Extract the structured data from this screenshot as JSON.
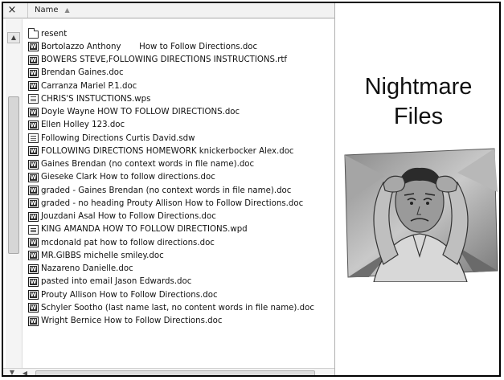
{
  "explorer": {
    "close_icon": "×",
    "column_header": "Name",
    "sort_icon": "sort-ascending-icon",
    "files": [
      {
        "name": "resent",
        "type": "folder"
      },
      {
        "name": "Bortolazzo Anthony       How to Follow Directions.doc",
        "type": "doc"
      },
      {
        "name": "BOWERS STEVE,FOLLOWING DIRECTIONS INSTRUCTIONS.rtf",
        "type": "doc"
      },
      {
        "name": "Brendan Gaines.doc",
        "type": "doc"
      },
      {
        "name": "Carranza Mariel P.1.doc",
        "type": "doc"
      },
      {
        "name": "CHRIS'S INSTUCTIONS.wps",
        "type": "wps"
      },
      {
        "name": "Doyle Wayne HOW TO FOLLOW DIRECTIONS.doc",
        "type": "doc"
      },
      {
        "name": "Ellen Holley 123.doc",
        "type": "doc"
      },
      {
        "name": "Following Directions Curtis David.sdw",
        "type": "wps"
      },
      {
        "name": "FOLLOWING DIRECTIONS HOMEWORK knickerbocker Alex.doc",
        "type": "doc"
      },
      {
        "name": "Gaines Brendan (no context words in file name).doc",
        "type": "doc"
      },
      {
        "name": "Gieseke Clark How to follow directions.doc",
        "type": "doc"
      },
      {
        "name": "graded - Gaines Brendan (no context words in file name).doc",
        "type": "doc"
      },
      {
        "name": "graded - no heading Prouty Allison How to Follow Directions.doc",
        "type": "doc"
      },
      {
        "name": "Jouzdani Asal How to Follow Directions.doc",
        "type": "doc"
      },
      {
        "name": "KING AMANDA HOW TO FOLLOW DIRECTIONS.wpd",
        "type": "wpd"
      },
      {
        "name": "mcdonald pat how to follow directions.doc",
        "type": "doc"
      },
      {
        "name": "MR.GIBBS michelle smiley.doc",
        "type": "doc"
      },
      {
        "name": "Nazareno Danielle.doc",
        "type": "doc"
      },
      {
        "name": "pasted into email Jason Edwards.doc",
        "type": "doc"
      },
      {
        "name": "Prouty Allison How to Follow Directions.doc",
        "type": "doc"
      },
      {
        "name": "Schyler Sootho (last name last, no content words in file name).doc",
        "type": "doc"
      },
      {
        "name": "Wright Bernice How to Follow Directions.doc",
        "type": "doc"
      }
    ]
  },
  "slide": {
    "title_line1": "Nightmare",
    "title_line2": "Files",
    "clipart": "stressed-man-clipart"
  },
  "colors": {
    "border": "#000000",
    "header_bg": "#f2f2f2",
    "scroll_bg": "#f4f4f4"
  }
}
